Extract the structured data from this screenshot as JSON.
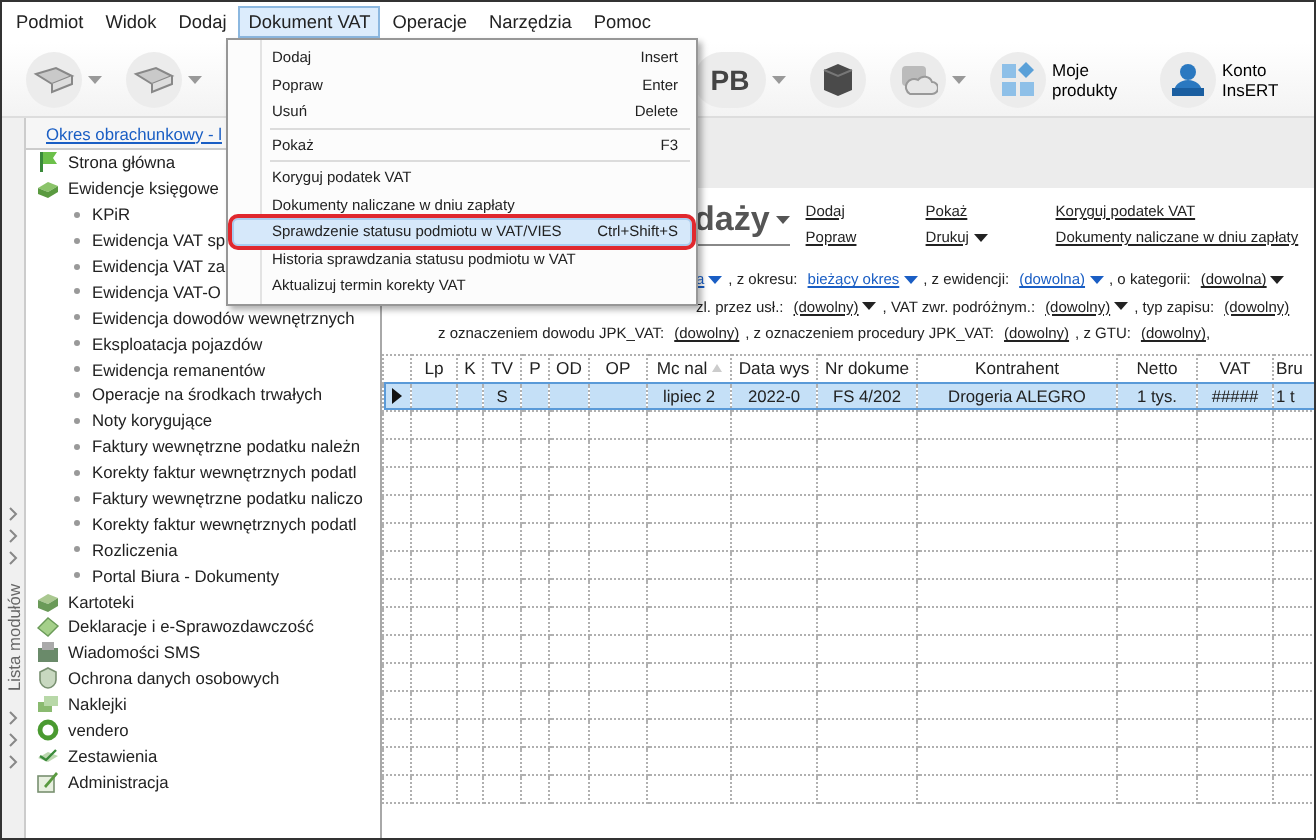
{
  "menubar": [
    {
      "label": "Podmiot",
      "selected": false
    },
    {
      "label": "Widok",
      "selected": false
    },
    {
      "label": "Dodaj",
      "selected": false
    },
    {
      "label": "Dokument VAT",
      "selected": true
    },
    {
      "label": "Operacje",
      "selected": false
    },
    {
      "label": "Narzędzia",
      "selected": false
    },
    {
      "label": "Pomoc",
      "selected": false
    }
  ],
  "toolbar": {
    "pb_button": "PB",
    "products_button": "Moje produkty",
    "account_button": "Konto InsERT"
  },
  "popup": {
    "items": [
      {
        "kind": "item",
        "label": "Dodaj",
        "shortcut": "Insert",
        "selected": false,
        "outlined": false
      },
      {
        "kind": "item",
        "label": "Popraw",
        "shortcut": "Enter",
        "selected": false,
        "outlined": false
      },
      {
        "kind": "item",
        "label": "Usuń",
        "shortcut": "Delete",
        "selected": false,
        "outlined": false
      },
      {
        "kind": "separator"
      },
      {
        "kind": "item",
        "label": "Pokaż",
        "shortcut": "F3",
        "selected": false,
        "outlined": false
      },
      {
        "kind": "separator"
      },
      {
        "kind": "item",
        "label": "Koryguj podatek VAT",
        "selected": false,
        "outlined": false
      },
      {
        "kind": "item",
        "label": "Dokumenty naliczane w dniu zapłaty",
        "selected": false,
        "outlined": false
      },
      {
        "kind": "item",
        "label": "Sprawdzenie statusu podmiotu w VAT/VIES",
        "shortcut": "Ctrl+Shift+S",
        "selected": true,
        "outlined": true
      },
      {
        "kind": "item",
        "label": "Historia sprawdzania statusu podmiotu w VAT",
        "selected": false,
        "outlined": false
      },
      {
        "kind": "item",
        "label": "Aktualizuj termin korekty VAT",
        "selected": false,
        "outlined": false
      }
    ]
  },
  "nav": {
    "period_link": "Okres obrachunkowy - l",
    "side_label": "Lista modułów",
    "items": [
      {
        "label": "Strona główna"
      },
      {
        "label": "Ewidencje księgowe",
        "children": [
          {
            "label": "KPiR"
          },
          {
            "label": "Ewidencja VAT sp"
          },
          {
            "label": "Ewidencja VAT za"
          },
          {
            "label": "Ewidencja VAT-O"
          },
          {
            "label": "Ewidencja dowodów wewnętrznych"
          },
          {
            "label": "Eksploatacja pojazdów"
          },
          {
            "label": "Ewidencja remanentów"
          },
          {
            "label": "Operacje na środkach trwałych"
          },
          {
            "label": "Noty korygujące"
          },
          {
            "label": "Faktury wewnętrzne podatku należn"
          },
          {
            "label": "Korekty faktur wewnętrznych podatl"
          },
          {
            "label": "Faktury wewnętrzne podatku naliczo"
          },
          {
            "label": "Korekty faktur wewnętrznych podatl"
          },
          {
            "label": "Rozliczenia"
          },
          {
            "label": "Portal Biura - Dokumenty"
          }
        ]
      },
      {
        "label": "Kartoteki"
      },
      {
        "label": "Deklaracje i e-Sprawozdawczość"
      },
      {
        "label": "Wiadomości SMS"
      },
      {
        "label": "Ochrona danych osobowych"
      },
      {
        "label": "Naklejki"
      },
      {
        "label": "vendero"
      },
      {
        "label": "Zestawienia"
      },
      {
        "label": "Administracja"
      }
    ]
  },
  "view": {
    "title": "daży",
    "actions": [
      [
        {
          "label": "Dodaj",
          "dropdown": false
        },
        {
          "label": "Popraw",
          "dropdown": false
        }
      ],
      [
        {
          "label": "Pokaż",
          "dropdown": false
        },
        {
          "label": "Drukuj",
          "dropdown": true
        }
      ],
      [
        {
          "label": "Koryguj podatek VAT",
          "dropdown": false
        },
        {
          "label": "Dokumenty naliczane w dniu zapłaty",
          "dropdown": false
        }
      ]
    ],
    "filters": [
      [
        {
          "value": "a",
          "dropdown": true,
          "active": true
        },
        {
          "prefix": ", z okresu:",
          "value": "bieżący okres",
          "dropdown": true,
          "active": true
        },
        {
          "prefix": ", z ewidencji:",
          "value": "(dowolna)",
          "dropdown": true,
          "active": true
        },
        {
          "prefix": ", o kategorii:",
          "value": "(dowolna)",
          "dropdown": true,
          "active": false
        }
      ],
      [
        {
          "prefix": "zl. przez usł.:",
          "value": "(dowolny)",
          "dropdown": true,
          "active": false
        },
        {
          "prefix": ", VAT zwr. podróżnym.:",
          "value": "(dowolny)",
          "dropdown": true,
          "active": false
        },
        {
          "prefix": ", typ zapisu:",
          "value": "(dowolny)",
          "dropdown": false,
          "active": false
        }
      ],
      [
        {
          "prefix": "z oznaczeniem dowodu JPK_VAT:",
          "value": "(dowolny)",
          "dropdown": false,
          "active": false
        },
        {
          "prefix": ", z oznaczeniem procedury JPK_VAT:",
          "value": "(dowolny)",
          "dropdown": false,
          "active": false
        },
        {
          "prefix": ", z GTU:",
          "value": "(dowolny)",
          "dropdown": false,
          "active": false
        },
        {
          "prefix": ","
        }
      ]
    ]
  },
  "table": {
    "columns": [
      "Lp",
      "K",
      "TV",
      "P",
      "OD",
      "OP",
      "Mc nal",
      "Data wys",
      "Nr dokume",
      "Kontrahent",
      "Netto",
      "VAT",
      "Bru"
    ],
    "rows": [
      {
        "selected": true,
        "cells": [
          "",
          "",
          "S",
          "",
          "",
          "",
          "lipiec 2",
          "2022-0",
          "FS 4/202",
          "Drogeria ALEGRO",
          "1 tys.",
          "#####",
          "1 t"
        ]
      }
    ]
  }
}
